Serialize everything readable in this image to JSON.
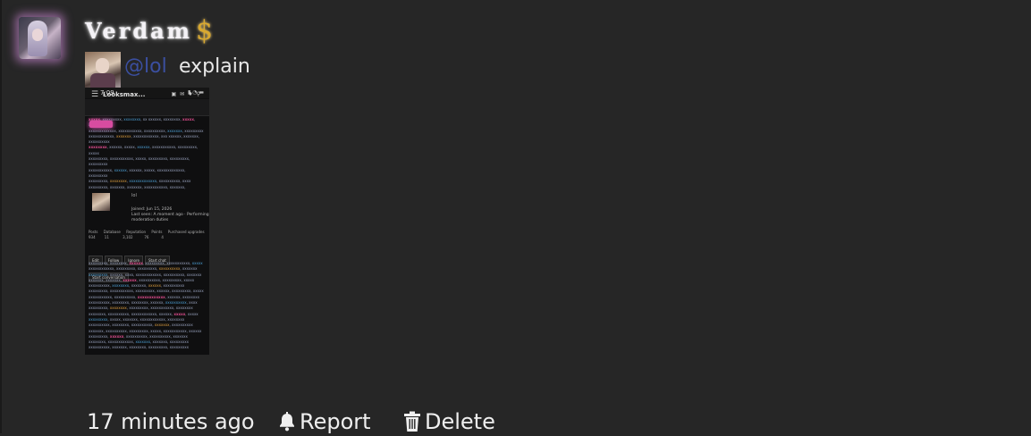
{
  "post": {
    "username": "Verdam",
    "badge_icon": "dollar-icon",
    "badge_glyph": "$",
    "reply": {
      "mention": "@lol",
      "message": "explain"
    },
    "attachment": {
      "status_time": "7:09",
      "site_title": "Looksmax...",
      "user_tag": "lol",
      "joined_lines": [
        "Joined: Jun 15, 2026",
        "Last seen: A moment ago · Performing",
        "moderation duties"
      ],
      "stats_labels": "Posts     Database     Reputation     Points     Purchased upgrades",
      "stats_values": "934        11            3,102          76           4",
      "buttons": [
        "Edit",
        "Follow",
        "Ignore",
        "Start chat",
        "Start conversation"
      ]
    },
    "footer": {
      "timestamp": "17 minutes ago",
      "report_label": "Report",
      "delete_label": "Delete"
    }
  },
  "colors": {
    "background": "#262626",
    "mention": "#3b4fa0",
    "badge": "#d8a830",
    "avatar_glow": "#e196eb"
  }
}
